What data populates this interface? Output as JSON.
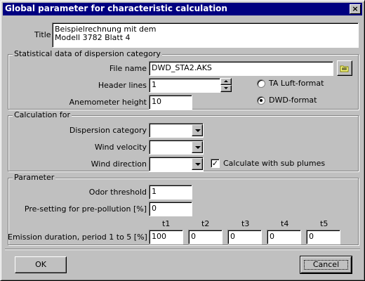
{
  "window": {
    "title": "Global parameter for characteristic calculation",
    "close_glyph": "×"
  },
  "title_field": {
    "label": "Title",
    "value_line1": "Beispielrechnung mit dem",
    "value_line2": "Modell 3782 Blatt 4"
  },
  "stat_group": {
    "title": "Statistical data of dispersion category",
    "file_name_label": "File name",
    "file_name_value": "DWD_STA2.AKS",
    "header_lines_label": "Header lines",
    "header_lines_value": "1",
    "anemometer_label": "Anemometer height",
    "anemometer_value": "10",
    "format_options": [
      {
        "label": "TA Luft-format",
        "selected": false
      },
      {
        "label": "DWD-format",
        "selected": true
      }
    ]
  },
  "calc_group": {
    "title": "Calculation for",
    "dispersion_label": "Dispersion category",
    "dispersion_value": "",
    "wind_velocity_label": "Wind velocity",
    "wind_velocity_value": "",
    "wind_direction_label": "Wind direction",
    "wind_direction_value": "",
    "sub_plumes_label": "Calculate with sub plumes",
    "sub_plumes_checked": true,
    "check_glyph": "✓"
  },
  "param_group": {
    "title": "Parameter",
    "odor_label": "Odor threshold",
    "odor_value": "1",
    "prepollution_label": "Pre-setting for pre-pollution [%]",
    "prepollution_value": "0",
    "emission_label": "Emission duration, period 1 to 5 [%]",
    "periods": [
      {
        "header": "t1",
        "value": "100"
      },
      {
        "header": "t2",
        "value": "0"
      },
      {
        "header": "t3",
        "value": "0"
      },
      {
        "header": "t4",
        "value": "0"
      },
      {
        "header": "t5",
        "value": "0"
      }
    ]
  },
  "buttons": {
    "ok": "OK",
    "cancel": "Cancel"
  }
}
